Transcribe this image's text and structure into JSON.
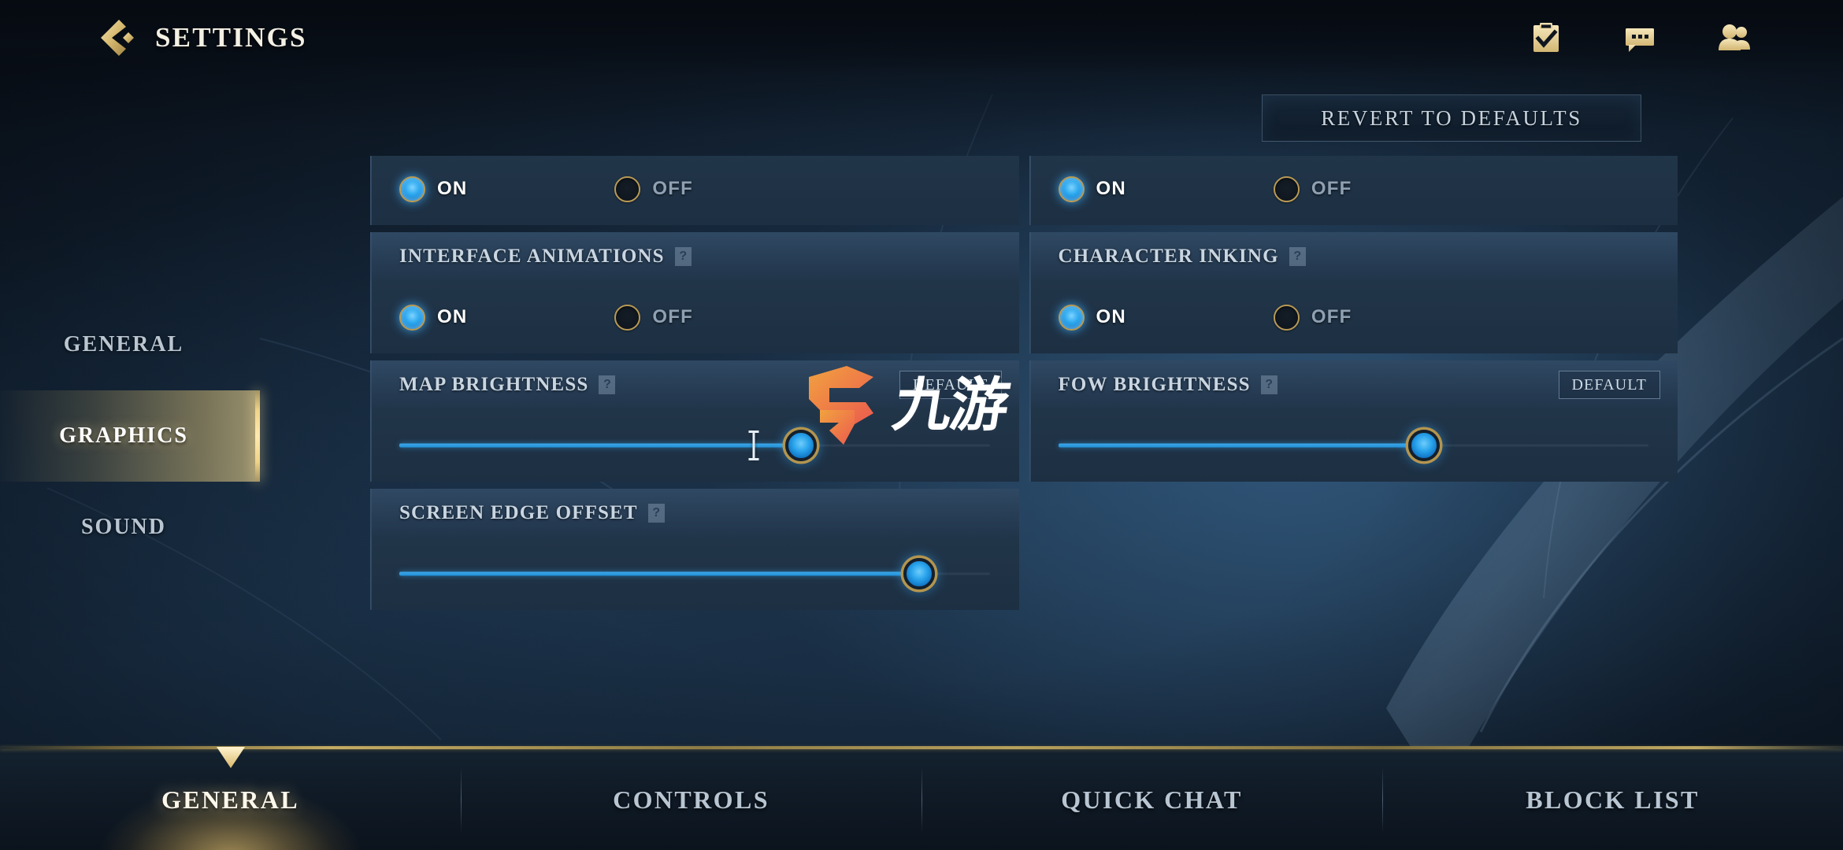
{
  "header": {
    "title": "SETTINGS",
    "back_icon": "back-chevron-icon",
    "icons": [
      {
        "name": "missions-clipboard-icon",
        "label": "Missions"
      },
      {
        "name": "chat-bubble-icon",
        "label": "Chat"
      },
      {
        "name": "friends-people-icon",
        "label": "Friends"
      }
    ]
  },
  "revert": {
    "label": "REVERT TO DEFAULTS"
  },
  "sidebar": {
    "items": [
      {
        "label": "GENERAL",
        "active": false
      },
      {
        "label": "GRAPHICS",
        "active": true
      },
      {
        "label": "SOUND",
        "active": false
      }
    ]
  },
  "settings": {
    "help_glyph": "?",
    "default_label": "DEFAULT",
    "left_column": [
      {
        "name": "clipped-toggle-row",
        "title": "",
        "type": "radio",
        "clipped": true,
        "options": [
          {
            "label": "ON",
            "selected": true
          },
          {
            "label": "OFF",
            "selected": false
          }
        ]
      },
      {
        "name": "interface-animations",
        "title": "INTERFACE ANIMATIONS",
        "type": "radio",
        "help": true,
        "options": [
          {
            "label": "ON",
            "selected": true
          },
          {
            "label": "OFF",
            "selected": false
          }
        ]
      },
      {
        "name": "map-brightness",
        "title": "MAP BRIGHTNESS",
        "type": "slider",
        "help": true,
        "has_default_button": true,
        "value_percent": 68,
        "default_tick_percent": 60,
        "occluded_by_watermark": true
      },
      {
        "name": "screen-edge-offset",
        "title": "SCREEN EDGE OFFSET",
        "type": "slider",
        "help": true,
        "has_default_button": false,
        "value_percent": 88,
        "default_tick_percent": null
      }
    ],
    "right_column": [
      {
        "name": "clipped-toggle-row",
        "title": "",
        "type": "radio",
        "clipped": true,
        "options": [
          {
            "label": "ON",
            "selected": true
          },
          {
            "label": "OFF",
            "selected": false
          }
        ]
      },
      {
        "name": "character-inking",
        "title": "CHARACTER INKING",
        "type": "radio",
        "help": true,
        "options": [
          {
            "label": "ON",
            "selected": true
          },
          {
            "label": "OFF",
            "selected": false
          }
        ]
      },
      {
        "name": "fow-brightness",
        "title": "FOW BRIGHTNESS",
        "type": "slider",
        "help": true,
        "has_default_button": true,
        "value_percent": 62,
        "default_tick_percent": null
      }
    ]
  },
  "tabs": [
    {
      "label": "GENERAL",
      "active": true
    },
    {
      "label": "CONTROLS",
      "active": false
    },
    {
      "label": "QUICK CHAT",
      "active": false
    },
    {
      "label": "BLOCK LIST",
      "active": false
    }
  ],
  "watermark": {
    "text": "九游",
    "glyph": "jiuyou-logo-mark"
  },
  "colors": {
    "gold": "#c8ab63",
    "gold_bright": "#ffe9b0",
    "accent_blue": "#2aa4ec",
    "panel": "#213549",
    "panel_header": "#385370",
    "text_primary": "#c9d6e2",
    "text_selected": "#ffffff",
    "watermark_orange": "#ef7b45"
  }
}
